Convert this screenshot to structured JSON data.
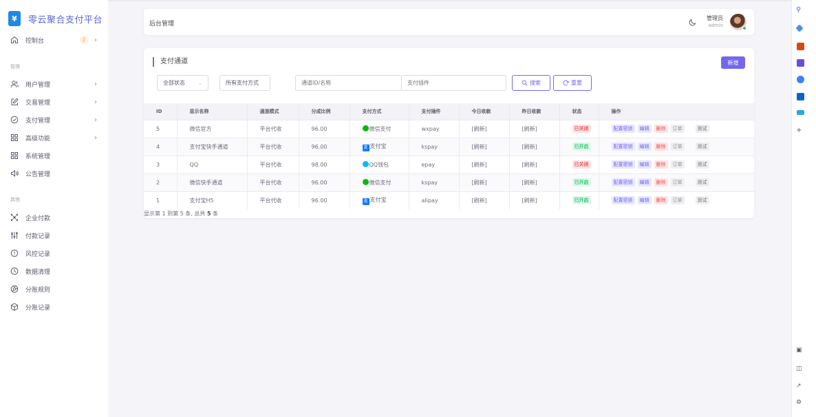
{
  "brand": {
    "logo_char": "¥",
    "title": "零云聚合支付平台"
  },
  "sidebar": {
    "dashboard": {
      "label": "控制台",
      "badge": "2"
    },
    "section_manage": "管理",
    "manage_items": [
      {
        "label": "用户管理",
        "has_chevron": true
      },
      {
        "label": "交易管理",
        "has_chevron": true
      },
      {
        "label": "支付管理",
        "has_chevron": true
      },
      {
        "label": "高级功能",
        "has_chevron": true
      },
      {
        "label": "系统管理",
        "has_chevron": false
      },
      {
        "label": "公告管理",
        "has_chevron": false
      }
    ],
    "section_other": "其他",
    "other_items": [
      {
        "label": "企业付款"
      },
      {
        "label": "付款记录"
      },
      {
        "label": "风控记录"
      },
      {
        "label": "数据清理"
      },
      {
        "label": "分账规则"
      },
      {
        "label": "分账记录"
      }
    ],
    "chevron": "›"
  },
  "header": {
    "title": "后台管理",
    "user_name": "管理员",
    "user_role": "admin"
  },
  "card": {
    "title": "支付通道",
    "add_button": "新增",
    "filters": {
      "status": "全部状态",
      "method": "所有支付方式",
      "channel_placeholder": "通道ID/名称",
      "plugin_placeholder": "支付插件",
      "search_button": "搜索",
      "reset_button": "重置"
    },
    "columns": [
      "ID",
      "显示名称",
      "通道模式",
      "分成比例",
      "支付方式",
      "支付插件",
      "今日收款",
      "昨日收款",
      "状态",
      "操作"
    ],
    "rows": [
      {
        "id": "5",
        "name": "微信官方",
        "mode": "平台代收",
        "rate": "96.00",
        "method": "微信支付",
        "method_type": "wx",
        "plugin": "wxpay",
        "today": "[刷新]",
        "yesterday": "[刷新]",
        "status": "已关闭",
        "status_on": false
      },
      {
        "id": "4",
        "name": "支付宝快手通道",
        "mode": "平台代收",
        "rate": "96.00",
        "method": "支付宝",
        "method_type": "ali",
        "plugin": "kspay",
        "today": "[刷新]",
        "yesterday": "[刷新]",
        "status": "已开启",
        "status_on": true
      },
      {
        "id": "3",
        "name": "QQ",
        "mode": "平台代收",
        "rate": "98.00",
        "method": "QQ钱包",
        "method_type": "qq",
        "plugin": "epay",
        "today": "[刷新]",
        "yesterday": "[刷新]",
        "status": "已关闭",
        "status_on": false
      },
      {
        "id": "2",
        "name": "微信快手通道",
        "mode": "平台代收",
        "rate": "96.00",
        "method": "微信支付",
        "method_type": "wx",
        "plugin": "kspay",
        "today": "[刷新]",
        "yesterday": "[刷新]",
        "status": "已开启",
        "status_on": true
      },
      {
        "id": "1",
        "name": "支付宝H5",
        "mode": "平台代收",
        "rate": "96.00",
        "method": "支付宝",
        "method_type": "ali",
        "plugin": "alipay",
        "today": "[刷新]",
        "yesterday": "[刷新]",
        "status": "已开启",
        "status_on": true
      }
    ],
    "ops": {
      "config": "配置密钥",
      "edit": "编辑",
      "delete": "删除",
      "order": "订单",
      "test": "测试"
    },
    "ali_glyph": "支",
    "summary": {
      "prefix": "显示第 1 到第 5 条, 总共 ",
      "total": "5",
      "suffix": " 条"
    }
  },
  "colors": {
    "accent": "#7367f0",
    "success": "#28c76f",
    "danger": "#ea5455",
    "brand_text": "#5a67d8"
  },
  "right_toolbar": [
    "search-icon",
    "tag-icon",
    "briefcase-icon",
    "user-icon",
    "settings-icon",
    "outlook-icon",
    "cart-icon",
    "plus-icon",
    "screen-icon",
    "sidebar-icon",
    "external-icon",
    "gear-icon"
  ]
}
